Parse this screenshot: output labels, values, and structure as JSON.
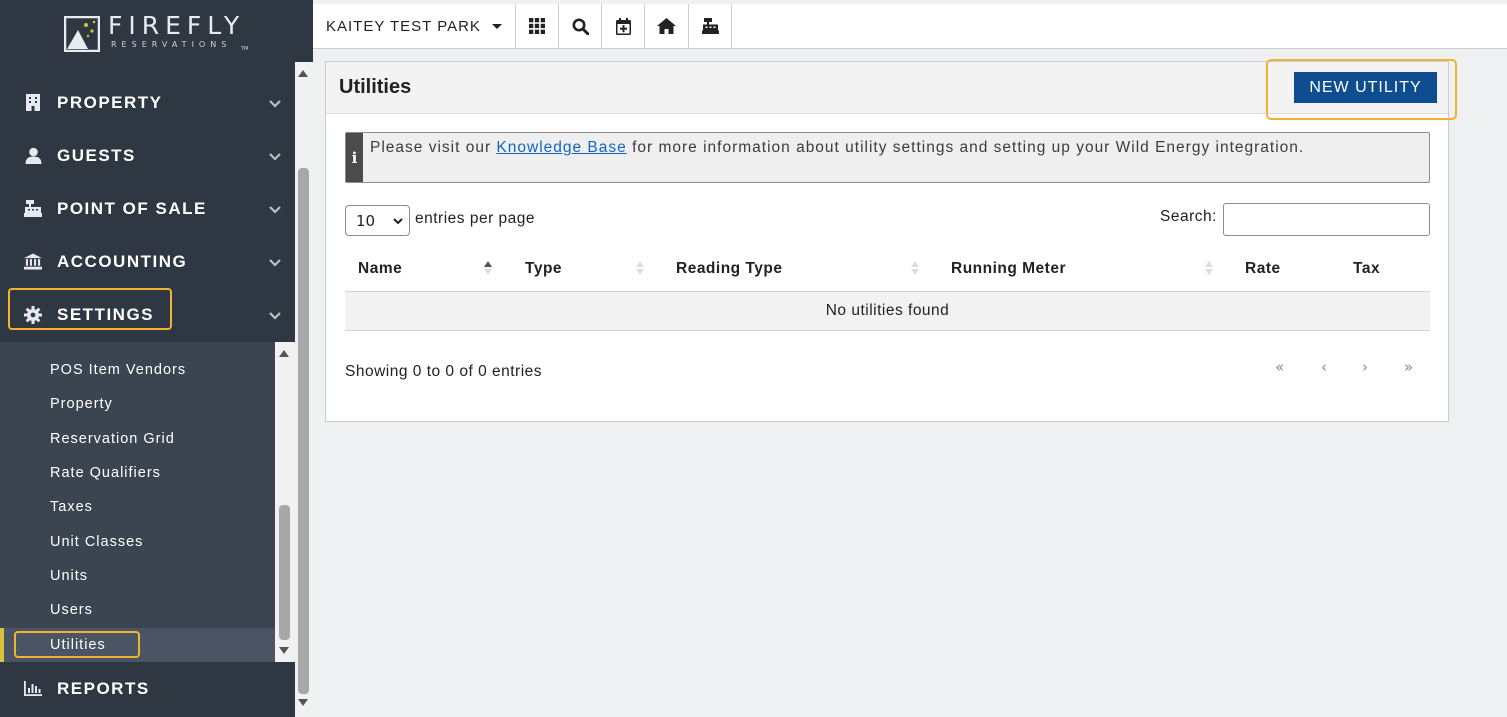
{
  "brand": {
    "name": "FIREFLY",
    "tagline": "RESERVATIONS",
    "tm": "TM"
  },
  "sidebar": {
    "items": [
      {
        "label": "PROPERTY",
        "icon": "building-icon"
      },
      {
        "label": "GUESTS",
        "icon": "user-icon"
      },
      {
        "label": "POINT OF SALE",
        "icon": "cash-register-icon"
      },
      {
        "label": "ACCOUNTING",
        "icon": "bank-icon"
      },
      {
        "label": "SETTINGS",
        "icon": "gear-icon"
      },
      {
        "label": "REPORTS",
        "icon": "bar-chart-icon"
      }
    ],
    "submenu": [
      "POS Item Vendors",
      "Property",
      "Reservation Grid",
      "Rate Qualifiers",
      "Taxes",
      "Unit Classes",
      "Units",
      "Users",
      "Utilities"
    ],
    "active_submenu": "Utilities",
    "active_color": "#d8c23b",
    "highlight_color": "#f2b232"
  },
  "topbar": {
    "park": "KAITEY TEST PARK",
    "buttons": [
      "grid-icon",
      "search-icon",
      "calendar-plus-icon",
      "home-icon",
      "cash-register-icon"
    ]
  },
  "page": {
    "title": "Utilities",
    "new_button": "NEW UTILITY",
    "info": {
      "before": "Please visit our ",
      "link": "Knowledge Base",
      "after": " for more information about utility settings and setting up your Wild Energy integration."
    },
    "length_value": "10",
    "length_label": "entries per page",
    "search_label": "Search:",
    "columns": [
      "Name",
      "Type",
      "Reading Type",
      "Running Meter",
      "Rate",
      "Tax"
    ],
    "empty": "No utilities found",
    "count": "Showing 0 to 0 of 0 entries",
    "pagination": [
      "«",
      "‹",
      "›",
      "»"
    ],
    "accent_color": "#0e4d8f"
  }
}
